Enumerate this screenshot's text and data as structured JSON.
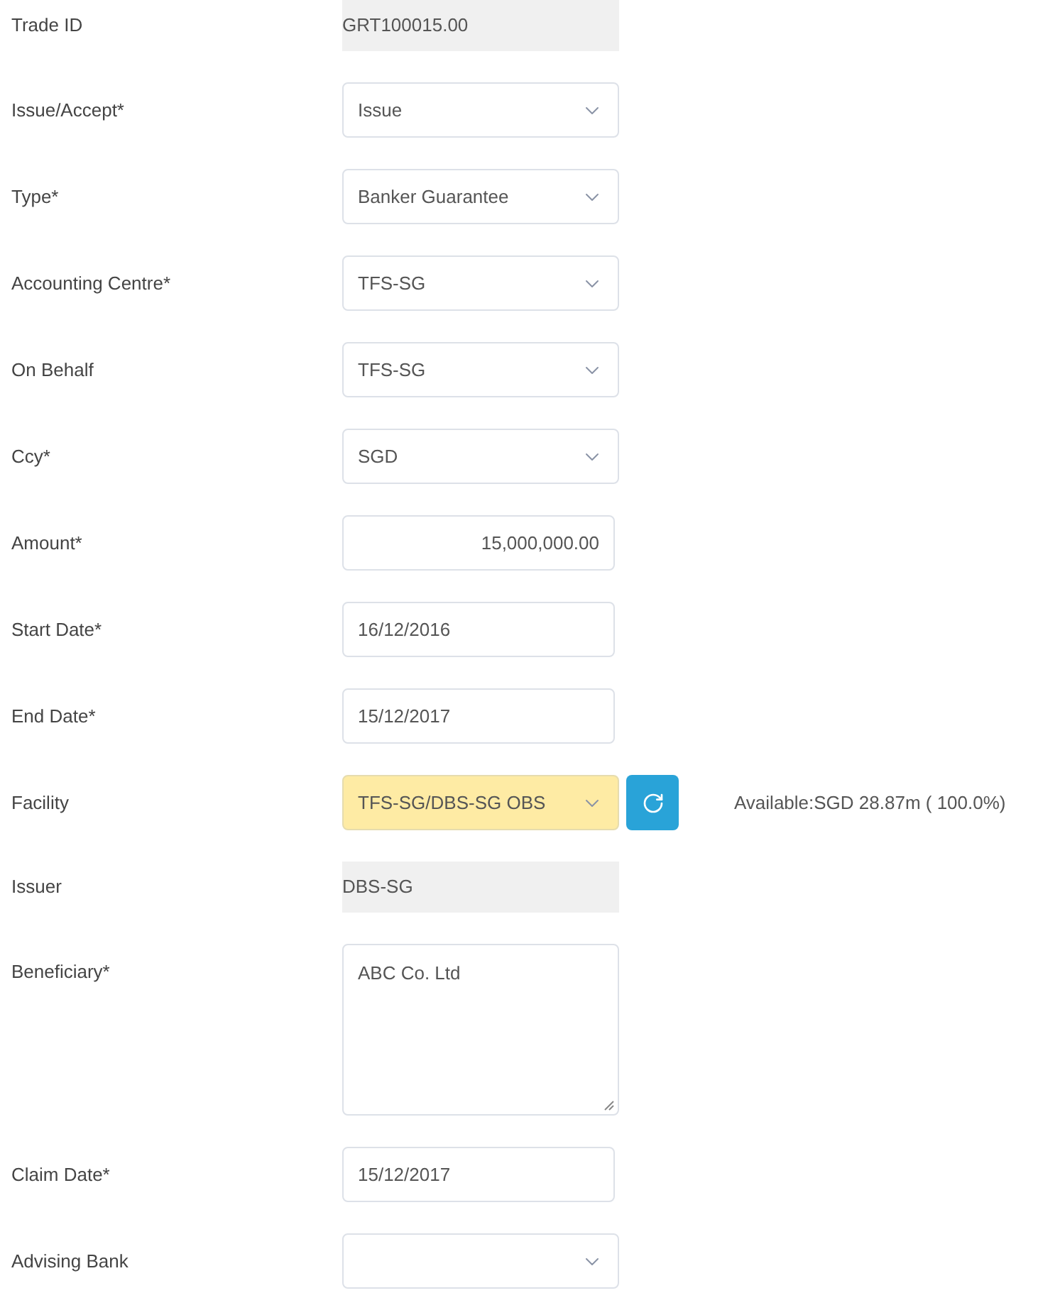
{
  "fields": [
    {
      "label": "Trade ID",
      "kind": "readonly",
      "value": "GRT100015.00"
    },
    {
      "label": "Issue/Accept*",
      "kind": "select",
      "value": "Issue"
    },
    {
      "label": "Type*",
      "kind": "select",
      "value": "Banker Guarantee"
    },
    {
      "label": "Accounting Centre*",
      "kind": "select",
      "value": "TFS-SG"
    },
    {
      "label": "On Behalf",
      "kind": "select",
      "value": "TFS-SG"
    },
    {
      "label": "Ccy*",
      "kind": "select",
      "value": "SGD"
    },
    {
      "label": "Amount*",
      "kind": "amount",
      "value": "15,000,000.00"
    },
    {
      "label": "Start Date*",
      "kind": "input",
      "value": "16/12/2016"
    },
    {
      "label": "End Date*",
      "kind": "input",
      "value": "15/12/2017"
    },
    {
      "label": "Facility",
      "kind": "facility",
      "value": "TFS-SG/DBS-SG OBS",
      "available": "Available:SGD 28.87m ( 100.0%)"
    },
    {
      "label": "Issuer",
      "kind": "readonly",
      "value": "DBS-SG"
    },
    {
      "label": "Beneficiary*",
      "kind": "textarea",
      "value": "ABC Co. Ltd"
    },
    {
      "label": "Claim Date*",
      "kind": "input",
      "value": "15/12/2017"
    },
    {
      "label": "Advising Bank",
      "kind": "select"
    }
  ]
}
